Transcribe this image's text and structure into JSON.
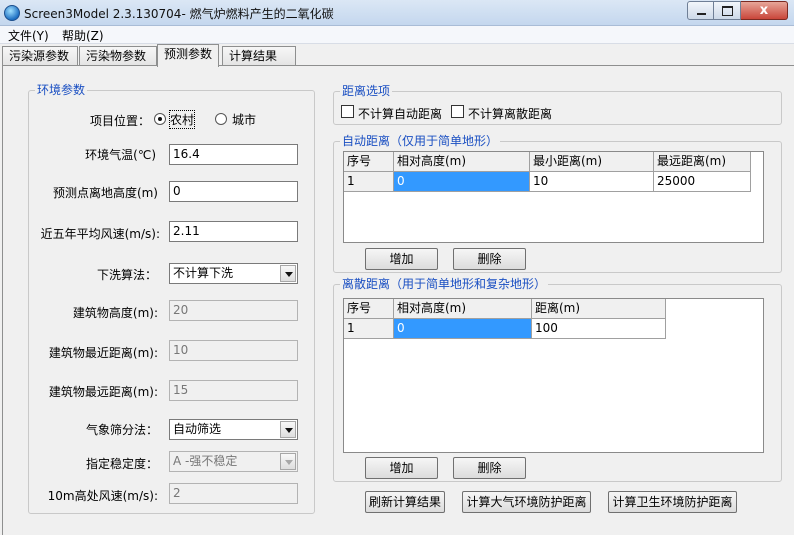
{
  "window": {
    "title": "Screen3Model 2.3.130704- 燃气炉燃料产生的二氧化碳",
    "close_glyph": "x"
  },
  "menu": [
    {
      "label": "文件(Y)"
    },
    {
      "label": "帮助(Z)"
    }
  ],
  "tabs": [
    {
      "label": "污染源参数",
      "active": false
    },
    {
      "label": "污染物参数",
      "active": false
    },
    {
      "label": "预测参数",
      "active": true
    },
    {
      "label": "计算结果",
      "active": false
    }
  ],
  "env": {
    "title": "环境参数",
    "location_label": "项目位置：",
    "location_options": [
      "农村",
      "城市"
    ],
    "location_selected": "农村",
    "temp_label": "环境气温(℃)",
    "temp_value": "16.4",
    "height_label": "预测点离地高度(m)",
    "height_value": "0",
    "wind_label": "近五年平均风速(m/s):",
    "wind_value": "2.11",
    "downwash_label": "下洗算法：",
    "downwash_value": "不计算下洗",
    "bh_label": "建筑物高度(m):",
    "bh_value": "20",
    "bmin_label": "建筑物最近距离(m):",
    "bmin_value": "10",
    "bmax_label": "建筑物最远距离(m):",
    "bmax_value": "15",
    "met_label": "气象筛分法：",
    "met_value": "自动筛选",
    "stab_label": "指定稳定度：",
    "stab_value": "A -强不稳定",
    "wind10_label": "10m高处风速(m/s):",
    "wind10_value": "2"
  },
  "dist_opts": {
    "title": "距离选项",
    "no_auto": "不计算自动距离",
    "no_discrete": "不计算离散距离"
  },
  "auto": {
    "title": "自动距离（仅用于简单地形）",
    "columns": [
      "序号",
      "相对高度(m)",
      "最小距离(m)",
      "最远距离(m)"
    ],
    "rows": [
      [
        "1",
        "0",
        "10",
        "25000"
      ]
    ],
    "add": "增加",
    "del": "删除"
  },
  "discrete": {
    "title": "离散距离（用于简单地形和复杂地形）",
    "columns": [
      "序号",
      "相对高度(m)",
      "距离(m)"
    ],
    "rows": [
      [
        "1",
        "0",
        "100"
      ]
    ],
    "add": "增加",
    "del": "删除"
  },
  "actions": {
    "refresh": "刷新计算结果",
    "air": "计算大气环境防护距离",
    "health": "计算卫生环境防护距离"
  }
}
